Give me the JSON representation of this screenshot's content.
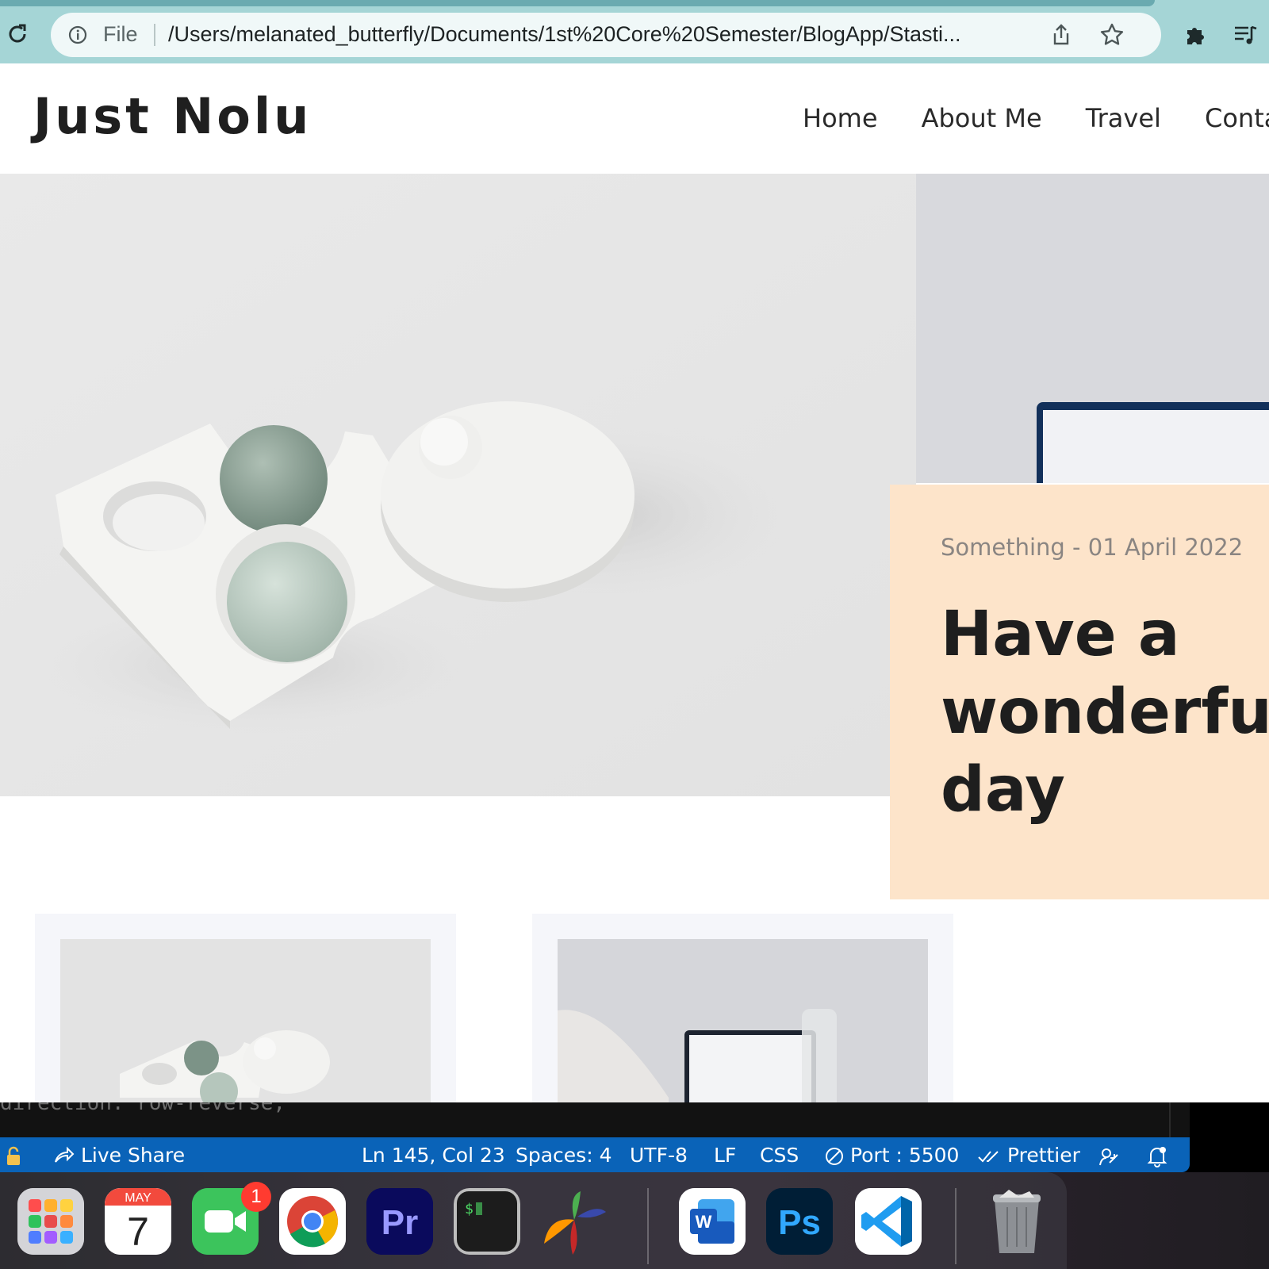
{
  "browser": {
    "scheme_label": "File",
    "url": "/Users/melanated_butterfly/Documents/1st%20Core%20Semester/BlogApp/Stasti..."
  },
  "site": {
    "brand": "Just Nolu",
    "nav": [
      "Home",
      "About Me",
      "Travel",
      "Contac"
    ]
  },
  "feature": {
    "meta": "Something - 01 April 2022",
    "title_lines": [
      "Have a",
      "wonderful",
      "day"
    ]
  },
  "editor": {
    "code_fragment": "direction: row-reverse;"
  },
  "statusbar": {
    "live_share": "Live Share",
    "position": "Ln 145, Col 23",
    "spaces": "Spaces: 4",
    "encoding": "UTF-8",
    "eol": "LF",
    "language": "CSS",
    "port": "Port : 5500",
    "prettier": "Prettier"
  },
  "dock": {
    "calendar_month": "MAY",
    "calendar_day": "7",
    "facetime_badge": "1",
    "premiere_label": "Pr",
    "photoshop_label": "Ps",
    "word_label": "W",
    "terminal_prompt": "$"
  },
  "colors": {
    "chrome_bg": "#a5d5d6",
    "feature_bg": "#fde4ca",
    "statusbar_bg": "#0a63b8",
    "card_bg": "#f5f6fa"
  }
}
